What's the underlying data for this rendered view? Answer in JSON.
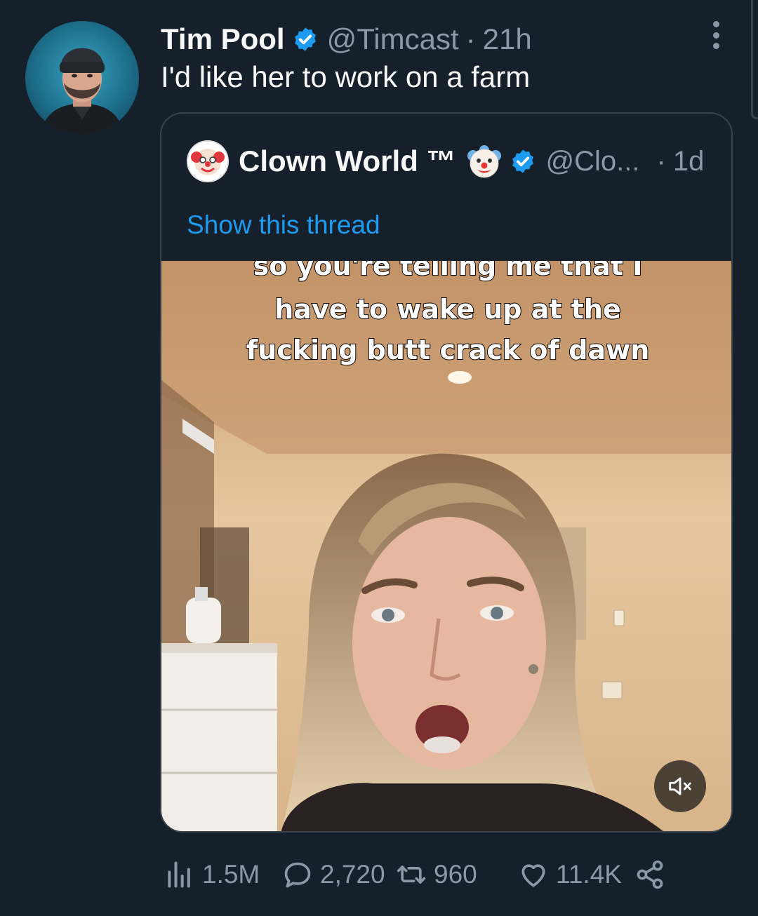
{
  "tweet": {
    "author_name": "Tim Pool",
    "handle": "@Timcast",
    "separator": "·",
    "time": "21h",
    "text": "I'd like her to work on a farm"
  },
  "quote": {
    "author_name": "Clown World ™",
    "emoji": "clown-face-emoji",
    "handle": "@Clo...",
    "separator": "·",
    "time": "1d",
    "show_thread": "Show this thread",
    "video_caption": [
      "so you're telling me that I",
      "have to wake up at the",
      "fucking butt crack of dawn"
    ]
  },
  "stats": {
    "views": "1.5M",
    "replies": "2,720",
    "retweets": "960",
    "likes": "11.4K"
  },
  "colors": {
    "background": "#15202b",
    "text_primary": "#f7f9f9",
    "text_secondary": "#8b98a5",
    "accent": "#1d9bf0",
    "border": "#38444d"
  },
  "icons": {
    "more": "more-vertical-icon",
    "verified": "verified-badge-icon",
    "views": "analytics-icon",
    "reply": "reply-icon",
    "retweet": "retweet-icon",
    "like": "heart-icon",
    "share": "share-icon",
    "mute": "volume-muted-icon"
  }
}
